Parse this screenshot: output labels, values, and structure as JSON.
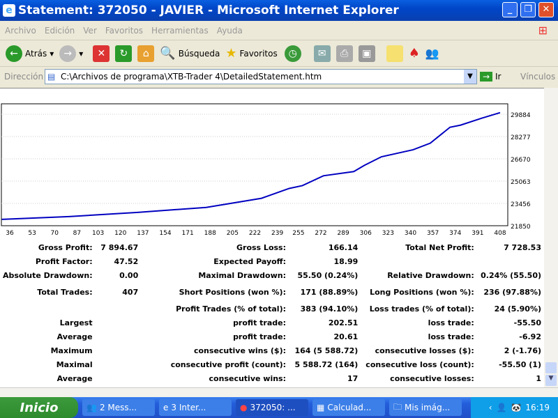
{
  "window": {
    "title": "Statement: 372050 - JAVIER - Microsoft Internet Explorer"
  },
  "menu": [
    "Archivo",
    "Edición",
    "Ver",
    "Favoritos",
    "Herramientas",
    "Ayuda"
  ],
  "toolbar": {
    "back": "Atrás",
    "search": "Búsqueda",
    "favorites": "Favoritos"
  },
  "address": {
    "label": "Dirección",
    "value": "C:\\Archivos de programa\\XTB-Trader 4\\DetailedStatement.htm",
    "go": "Ir",
    "links": "Vínculos"
  },
  "chart_data": {
    "type": "line",
    "x": [
      30,
      81,
      133,
      185,
      227,
      248,
      258,
      274,
      297,
      305,
      318,
      342,
      355,
      370,
      378,
      394,
      408
    ],
    "values": [
      22306,
      22509,
      22813,
      23168,
      23828,
      24537,
      24740,
      25450,
      25754,
      26200,
      26820,
      27327,
      27800,
      28948,
      29100,
      29600,
      30000
    ],
    "xticks": [
      "36",
      "53",
      "70",
      "87",
      "103",
      "120",
      "137",
      "154",
      "171",
      "188",
      "205",
      "222",
      "239",
      "255",
      "272",
      "289",
      "306",
      "323",
      "340",
      "357",
      "374",
      "391",
      "408"
    ],
    "yticks": [
      "29884",
      "28277",
      "26670",
      "25063",
      "23456",
      "21850"
    ],
    "ylim": [
      21850,
      30200
    ],
    "xlim": [
      30,
      413
    ],
    "color": "#0000c0",
    "grid": "horizontal dotted"
  },
  "stats": [
    [
      "Gross Profit:",
      "7 894.67",
      "Gross Loss:",
      "166.14",
      "Total Net Profit:",
      "7 728.53"
    ],
    [
      "Profit Factor:",
      "47.52",
      "Expected Payoff:",
      "18.99",
      "",
      ""
    ],
    [
      "Absolute Drawdown:",
      "0.00",
      "Maximal Drawdown:",
      "55.50 (0.24%)",
      "Relative Drawdown:",
      "0.24% (55.50)"
    ],
    [
      "Total Trades:",
      "407",
      "Short Positions (won %):",
      "171 (88.89%)",
      "Long Positions (won %):",
      "236 (97.88%)"
    ],
    [
      "",
      "",
      "Profit Trades (% of total):",
      "383 (94.10%)",
      "Loss trades (% of total):",
      "24 (5.90%)"
    ],
    [
      "Largest",
      "",
      "profit trade:",
      "202.51",
      "loss trade:",
      "-55.50"
    ],
    [
      "Average",
      "",
      "profit trade:",
      "20.61",
      "loss trade:",
      "-6.92"
    ],
    [
      "Maximum",
      "",
      "consecutive wins ($):",
      "164 (5 588.72)",
      "consecutive losses ($):",
      "2 (-1.76)"
    ],
    [
      "Maximal",
      "",
      "consecutive profit (count):",
      "5 588.72 (164)",
      "consecutive loss (count):",
      "-55.50 (1)"
    ],
    [
      "Average",
      "",
      "consecutive wins:",
      "17",
      "consecutive losses:",
      "1"
    ]
  ],
  "taskbar": {
    "start": "Inicio",
    "tasks": [
      "2 Mess...",
      "3 Inter...",
      "372050: ...",
      "Calculad...",
      "Mis imág..."
    ],
    "clock": "16:19"
  }
}
